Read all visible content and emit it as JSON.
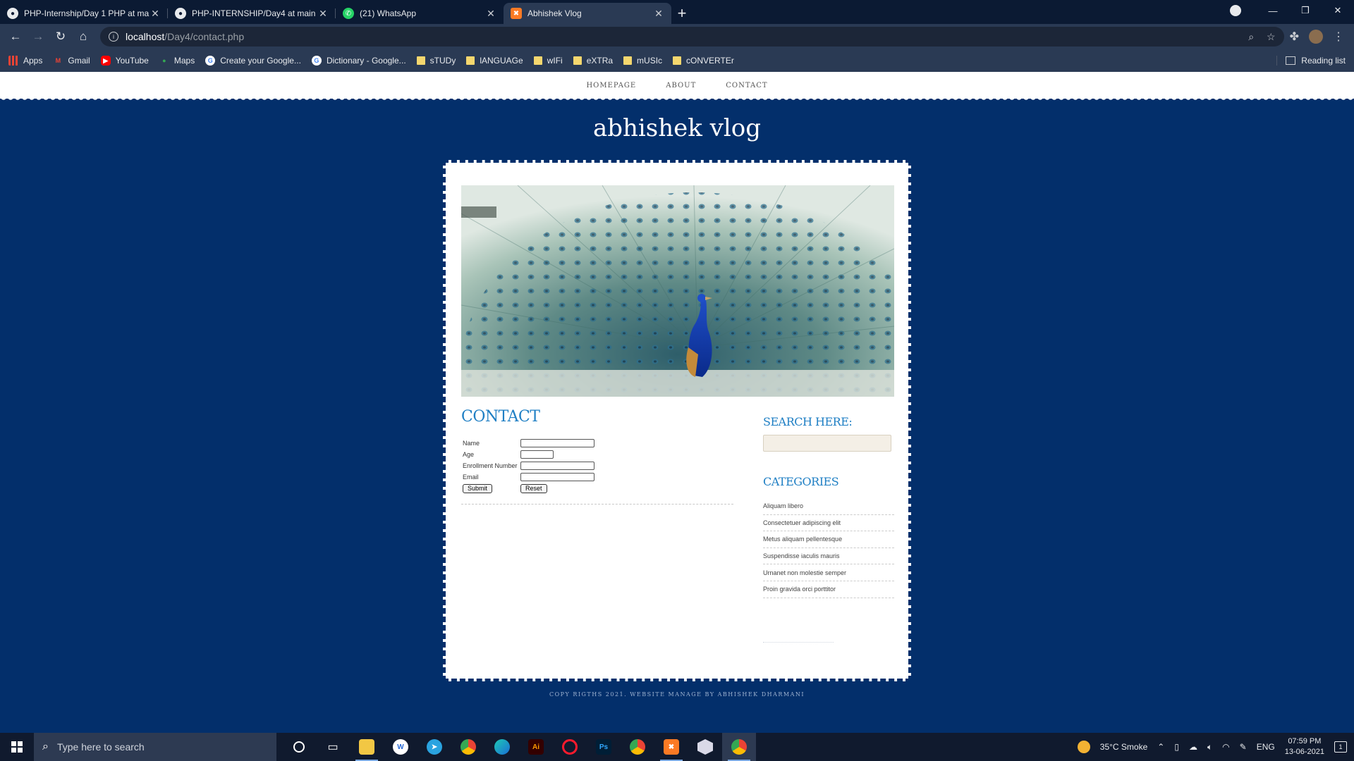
{
  "browser": {
    "tabs": [
      {
        "title": "PHP-Internship/Day 1 PHP at ma",
        "favicon": "github-icon"
      },
      {
        "title": "PHP-INTERNSHIP/Day4 at main ·",
        "favicon": "github-icon"
      },
      {
        "title": "(21) WhatsApp",
        "favicon": "whatsapp-icon"
      },
      {
        "title": "Abhishek Vlog",
        "favicon": "xampp-icon"
      }
    ],
    "url_host": "localhost",
    "url_path": "/Day4/contact.php",
    "bookmarks": [
      {
        "label": "Apps",
        "icon": "apps-grid-icon"
      },
      {
        "label": "Gmail",
        "icon": "gmail-icon"
      },
      {
        "label": "YouTube",
        "icon": "youtube-icon"
      },
      {
        "label": "Maps",
        "icon": "maps-icon"
      },
      {
        "label": "Create your Google...",
        "icon": "google-icon"
      },
      {
        "label": "Dictionary - Google...",
        "icon": "google-icon"
      },
      {
        "label": "sTUDy",
        "icon": "folder-icon"
      },
      {
        "label": "lANGUAGe",
        "icon": "folder-icon"
      },
      {
        "label": "wIFi",
        "icon": "folder-icon"
      },
      {
        "label": "eXTRa",
        "icon": "folder-icon"
      },
      {
        "label": "mUSIc",
        "icon": "folder-icon"
      },
      {
        "label": "cONVERTEr",
        "icon": "folder-icon"
      }
    ],
    "reading_list": "Reading list"
  },
  "site": {
    "nav": [
      "HOMEPAGE",
      "ABOUT",
      "CONTACT"
    ],
    "title": "abhishek vlog",
    "contact_heading": "CONTACT",
    "form": {
      "fields": [
        "Name",
        "Age",
        "Enrollment Number",
        "Email"
      ],
      "submit": "Submit",
      "reset": "Reset"
    },
    "search_heading": "SEARCH HERE:",
    "categories_heading": "CATEGORIES",
    "categories": [
      "Aliquam libero",
      "Consectetuer adipiscing elit",
      "Metus aliquam pellentesque",
      "Suspendisse iaculis mauris",
      "Urnanet non molestie semper",
      "Proin gravida orci porttitor"
    ],
    "footer": "COPY RIGTHS 2021. WEBSITE MANAGE BY ABHISHEK DHARMANI",
    "colors": {
      "background": "#032f6b",
      "heading": "#1f7fc4",
      "search_bg": "#f4efe6"
    }
  },
  "taskbar": {
    "search_placeholder": "Type here to search",
    "weather": "35°C  Smoke",
    "language": "ENG",
    "time": "07:59 PM",
    "date": "13-06-2021",
    "notifications": "1"
  }
}
